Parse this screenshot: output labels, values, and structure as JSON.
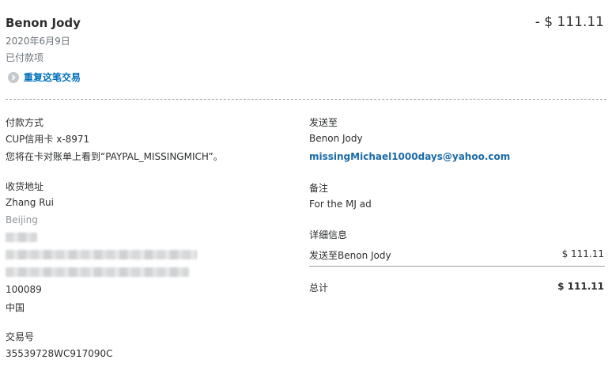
{
  "header": {
    "name": "Benon Jody",
    "amount": "- $ 111.11",
    "date": "2020年6月9日",
    "status": "已付款项",
    "repeat_label": "重复这笔交易"
  },
  "payment": {
    "label": "付款方式",
    "method": "CUP信用卡 x-8971",
    "note": "您将在卡对账单上看到“PAYPAL_MISSINGMICH”。"
  },
  "shipping": {
    "label": "收货地址",
    "name": "Zhang Rui",
    "city": "Beijing",
    "postcode": "100089",
    "country": "中国"
  },
  "transaction": {
    "label": "交易号",
    "id": "35539728WC917090C"
  },
  "sent_to": {
    "label": "发送至",
    "name": "Benon Jody",
    "email": "missingMichael1000days@yahoo.com"
  },
  "memo": {
    "label": "备注",
    "text": "For the MJ ad"
  },
  "details": {
    "label": "详细信息",
    "line_label": "发送至Benon Jody",
    "line_amount": "$ 111.11",
    "total_label": "总计",
    "total_amount": "$ 111.11"
  }
}
